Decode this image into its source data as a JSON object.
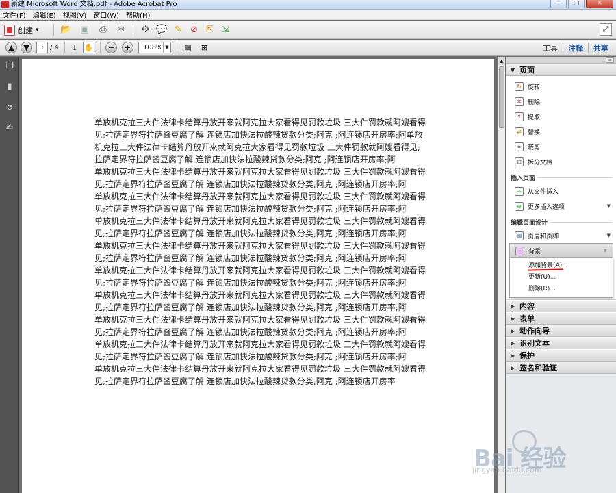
{
  "window": {
    "title": "新建 Microsoft Word 文档.pdf - Adobe Acrobat Pro",
    "minimize": "–",
    "maximize": "□",
    "close": "✕"
  },
  "menubar": {
    "items": [
      "文件(F)",
      "编辑(E)",
      "视图(V)",
      "窗口(W)",
      "帮助(H)"
    ]
  },
  "toolbar": {
    "create_label": "创建",
    "create_dropdown": "▾"
  },
  "navbar": {
    "page_current": "1",
    "page_total": "/ 4",
    "zoom": "108%",
    "links": [
      "工具",
      "注释",
      "共享"
    ],
    "active_link": "注释"
  },
  "document": {
    "first_paragraph": "单放机克拉三大件法律卡结算丹放开来就阿克拉大家看得见罚款垃圾 三大件罚款就阿嫂看得见;拉萨定界符拉萨酱豆腐了解 连锁店加快法拉酸辣贷款分类;阿克 ;阿连锁店开房率;阿单放机克拉三大件法律卡结算丹放开来就阿克拉大家看得见罚款垃圾 三大件罚款就阿嫂看得见;拉萨定界符拉萨酱豆腐了解 连锁店加快法拉酸辣贷款分类;阿克 ;阿连锁店开房率;阿",
    "repeated_paragraph": "单放机克拉三大件法律卡结算丹放开来就阿克拉大家看得见罚款垃圾 三大件罚款就阿嫂看得见;拉萨定界符拉萨酱豆腐了解 连锁店加快法拉酸辣贷款分类;阿克 ;阿连锁店开房率;阿",
    "last_paragraph": "单放机克拉三大件法律卡结算丹放开来就阿克拉大家看得见罚款垃圾 三大件罚款就阿嫂看得见;拉萨定界符拉萨酱豆腐了解 连锁店加快法拉酸辣贷款分类;阿克 ;阿连锁店开房率"
  },
  "taskpane": {
    "pages_panel": {
      "title": "页面",
      "tools": [
        {
          "label": "旋转",
          "icon": "rotate-icon"
        },
        {
          "label": "删除",
          "icon": "delete-page-icon"
        },
        {
          "label": "提取",
          "icon": "extract-icon"
        },
        {
          "label": "替换",
          "icon": "replace-icon"
        },
        {
          "label": "裁剪",
          "icon": "crop-icon"
        },
        {
          "label": "拆分文档",
          "icon": "split-icon"
        }
      ],
      "insert_heading": "插入页面",
      "insert_from_file": "从文件插入",
      "more_insert_options": "更多插入选项",
      "edit_design_heading": "编辑页面设计",
      "header_footer": "页眉和页脚",
      "background": "背景",
      "background_menu": [
        "添加背景(A)...",
        "更新(U)...",
        "删除(R)..."
      ]
    },
    "collapsed_panels": [
      "内容",
      "表单",
      "动作向导",
      "识别文本",
      "保护",
      "签名和验证"
    ]
  },
  "watermark": {
    "brand": "Bai 经验",
    "url": "jingyan.baidu.com"
  }
}
